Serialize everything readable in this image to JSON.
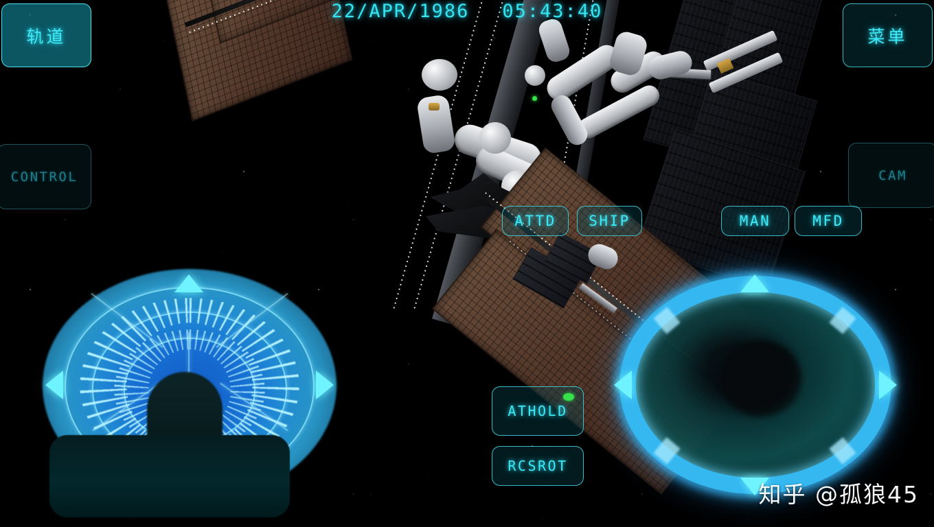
{
  "hud": {
    "date": "22/APR/1986",
    "time": "05:43:40"
  },
  "buttons": {
    "orbit": "轨道",
    "menu": "菜单",
    "control": "CONTROL",
    "cam": "CAM",
    "attd": "ATTD",
    "ship": "SHIP",
    "man": "MAN",
    "mfd": "MFD",
    "athold": "ATHOLD",
    "rcsrot": "RCSROT"
  },
  "indicators": {
    "athold_led": "on"
  },
  "watermark": "知乎 @孤狼45",
  "colors": {
    "hud_cyan": "#3ee8f4",
    "hud_cyan_dim": "#1d7e8c",
    "panel_fill": "rgba(10,95,110,.55)",
    "ring_blue": "#38beFA",
    "pad_blue": "#1878e4",
    "led_green": "#36e04a",
    "space_black": "#010103"
  }
}
